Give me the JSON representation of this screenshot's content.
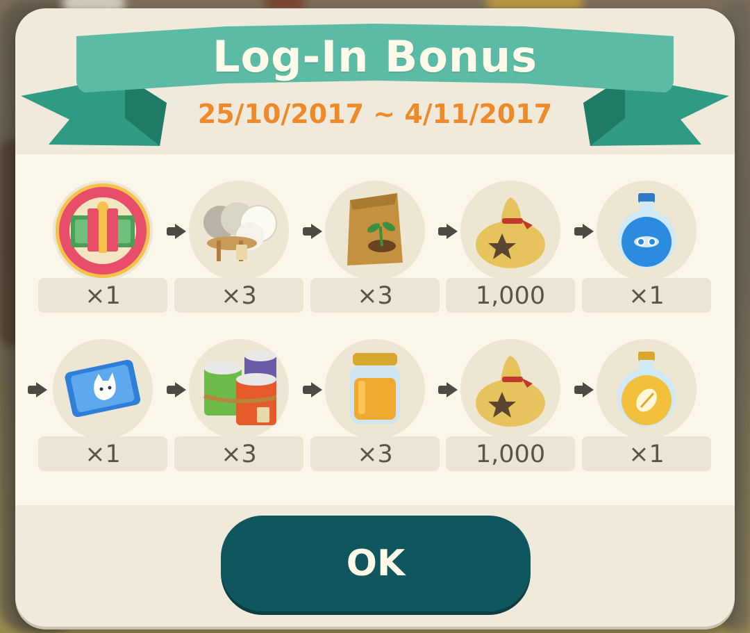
{
  "header": {
    "title": "Log-In Bonus",
    "date_range": "25/10/2017 ~ 4/11/2017"
  },
  "rewards": [
    {
      "icon": "gift-ticket-icon",
      "quantity": "×1"
    },
    {
      "icon": "cotton-bundle-icon",
      "quantity": "×3"
    },
    {
      "icon": "seed-bag-icon",
      "quantity": "×3"
    },
    {
      "icon": "bells-bag-icon",
      "quantity": "1,000"
    },
    {
      "icon": "blue-potion-icon",
      "quantity": "×1"
    },
    {
      "icon": "cat-card-icon",
      "quantity": "×1"
    },
    {
      "icon": "canned-food-bundle-icon",
      "quantity": "×3"
    },
    {
      "icon": "honey-jar-icon",
      "quantity": "×3"
    },
    {
      "icon": "bells-bag-icon",
      "quantity": "1,000"
    },
    {
      "icon": "gold-potion-icon",
      "quantity": "×1"
    }
  ],
  "buttons": {
    "ok_label": "OK"
  },
  "colors": {
    "ribbon": "#5cbba5",
    "ribbon_dark": "#2e9b82",
    "date_text": "#ef8a2b",
    "ok_button": "#10565e",
    "dialog_bg": "#efeadc",
    "panel_bg": "#faf7ea"
  }
}
